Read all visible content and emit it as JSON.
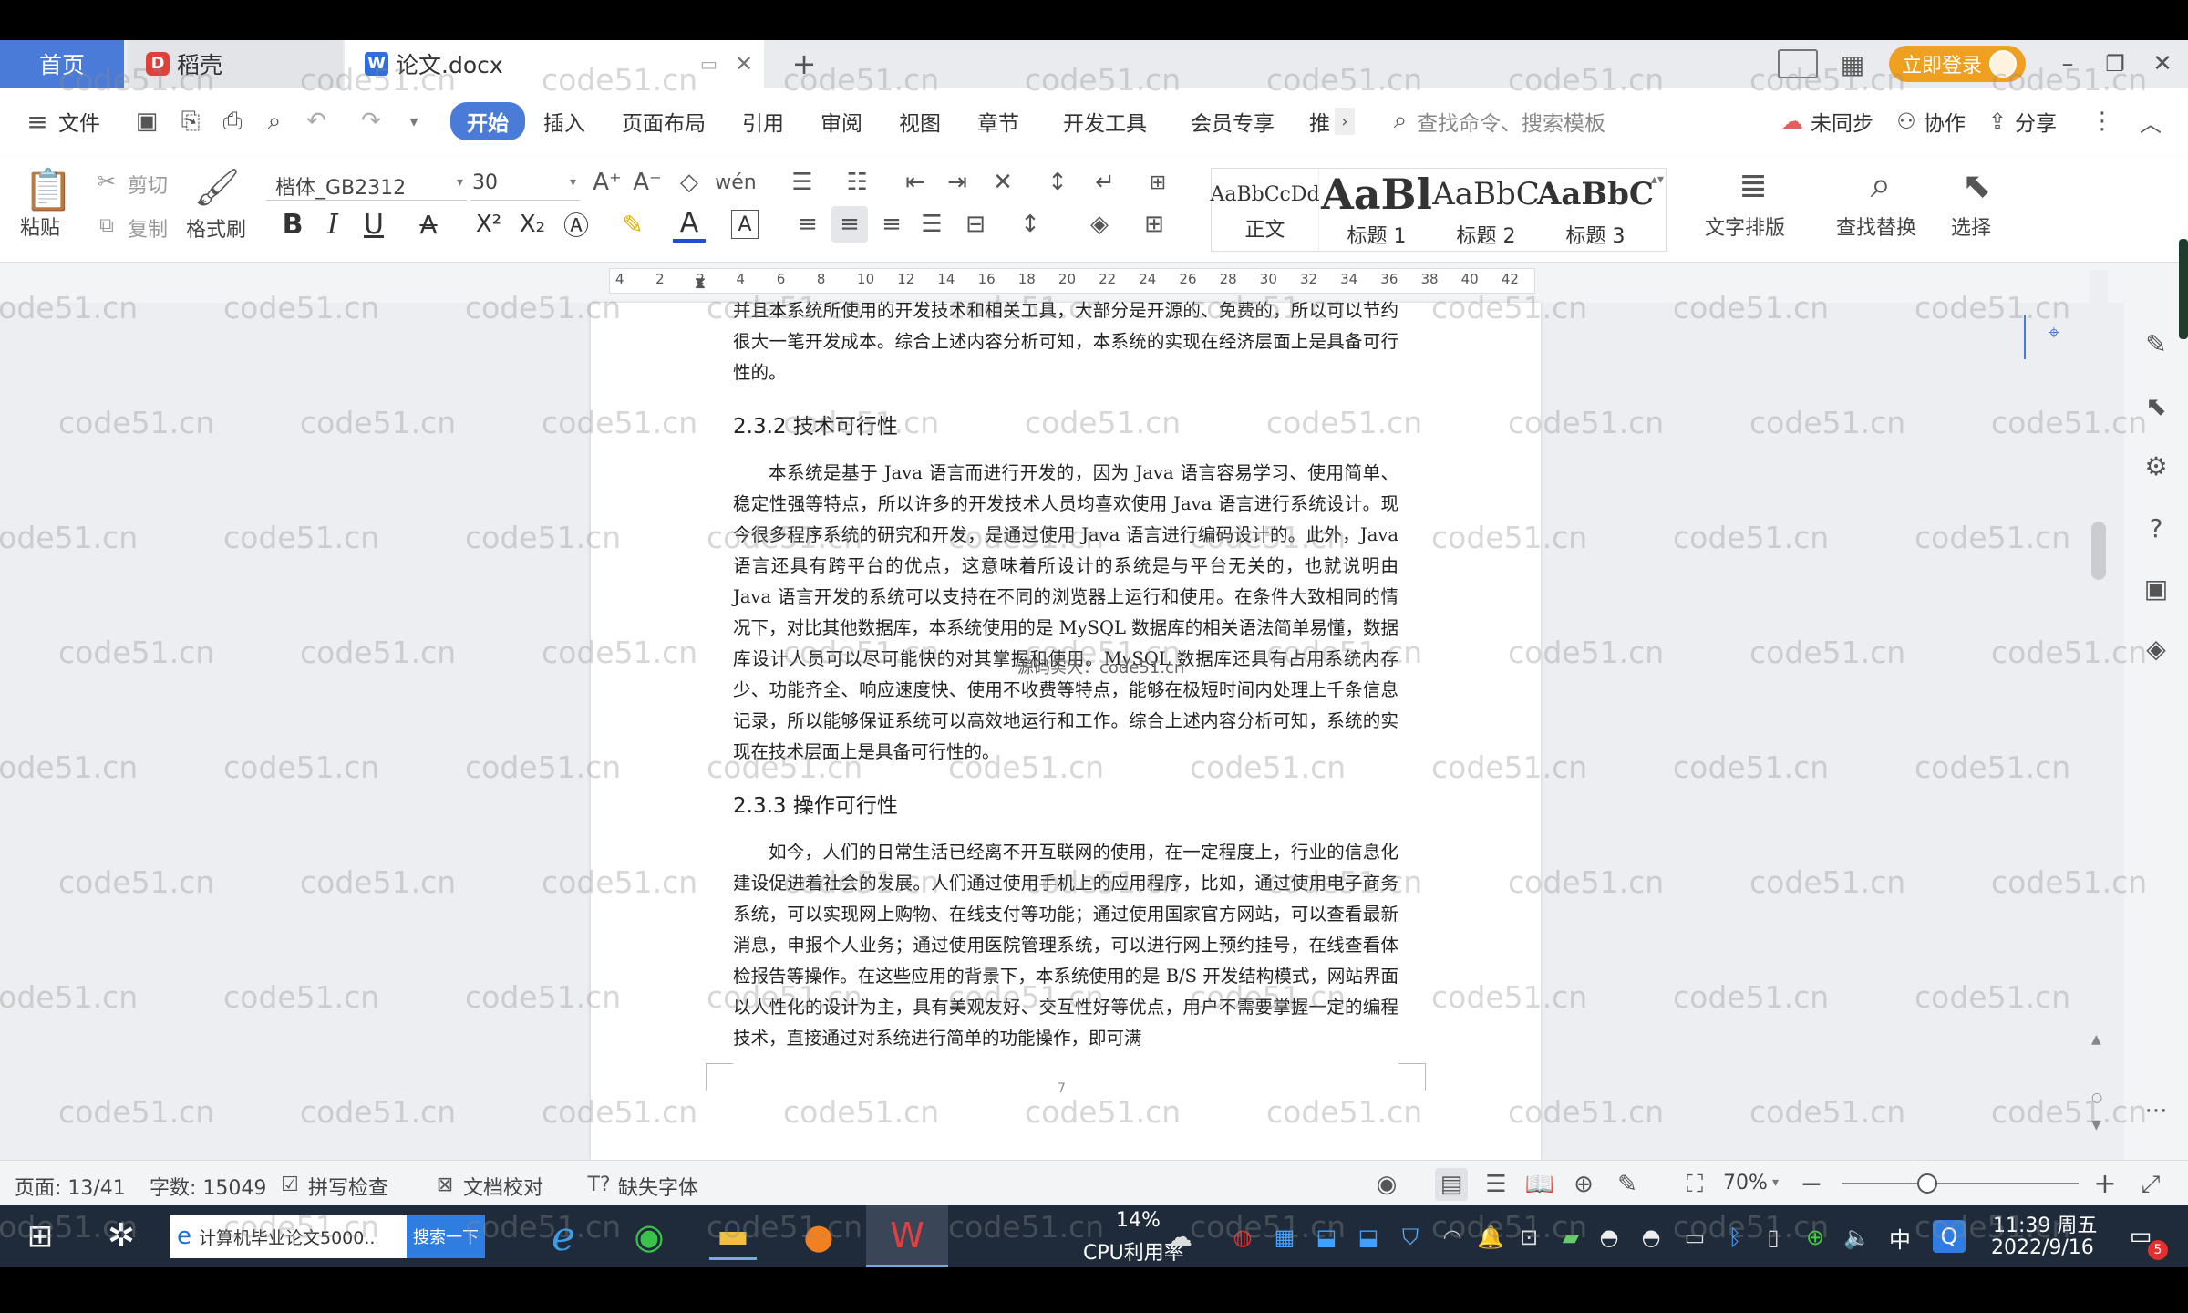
{
  "tabs": {
    "home": "首页",
    "daoke": "稻壳",
    "doc": "论文.docx",
    "login": "立即登录"
  },
  "menu": {
    "file": "文件",
    "items": [
      "开始",
      "插入",
      "页面布局",
      "引用",
      "审阅",
      "视图",
      "章节",
      "开发工具",
      "会员专享",
      "推"
    ],
    "search_placeholder": "查找命令、搜索模板",
    "sync": "未同步",
    "collab": "协作",
    "share": "分享"
  },
  "ribbon": {
    "paste": "粘贴",
    "cut": "剪切",
    "copy": "复制",
    "format_painter": "格式刷",
    "font": "楷体_GB2312",
    "size": "30",
    "styles": [
      {
        "preview": "AaBbCcDd",
        "name": "正文"
      },
      {
        "preview": "AaBl",
        "name": "标题 1"
      },
      {
        "preview": "AaBbC",
        "name": "标题 2"
      },
      {
        "preview": "AaBbC",
        "name": "标题 3"
      }
    ],
    "text_layout": "文字排版",
    "find_replace": "查找替换",
    "select": "选择"
  },
  "ruler": [
    "4",
    "2",
    "2",
    "4",
    "6",
    "8",
    "10",
    "12",
    "14",
    "16",
    "18",
    "20",
    "22",
    "24",
    "26",
    "28",
    "30",
    "32",
    "34",
    "36",
    "38",
    "40",
    "42"
  ],
  "document": {
    "para0": "并且本系统所使用的开发技术和相关工具，大部分是开源的、免费的，所以可以节约很大一笔开发成本。综合上述内容分析可知，本系统的实现在经济层面上是具备可行性的。",
    "h232": "2.3.2 技术可行性",
    "para1": "本系统是基于 Java 语言而进行开发的，因为 Java 语言容易学习、使用简单、稳定性强等特点，所以许多的开发技术人员均喜欢使用 Java 语言进行系统设计。现今很多程序系统的研究和开发，是通过使用 Java 语言进行编码设计的。此外，Java 语言还具有跨平台的优点，这意味着所设计的系统是与平台无关的，也就说明由 Java 语言开发的系统可以支持在不同的浏览器上运行和使用。在条件大致相同的情况下，对比其他数据库，本系统使用的是 MySQL 数据库的相关语法简单易懂，数据库设计人员可以尽可能快的对其掌握和使用。MySQL 数据库还具有占用系统内存少、功能齐全、响应速度快、使用不收费等特点，能够在极短时间内处理上千条信息记录，所以能够保证系统可以高效地运行和工作。综合上述内容分析可知，系统的实现在技术层面上是具备可行性的。",
    "h233": "2.3.3 操作可行性",
    "para2": "如今，人们的日常生活已经离不开互联网的使用，在一定程度上，行业的信息化建设促进着社会的发展。人们通过使用手机上的应用程序，比如，通过使用电子商务系统，可以实现网上购物、在线支付等功能；通过使用国家官方网站，可以查看最新消息，申报个人业务；通过使用医院管理系统，可以进行网上预约挂号，在线查看体检报告等操作。在这些应用的背景下，本系统使用的是 B/S 开发结构模式，网站界面以人性化的设计为主，具有美观友好、交互性好等优点，用户不需要掌握一定的编程技术，直接通过对系统进行简单的功能操作，即可满",
    "page_num": "7",
    "overlay": "源码实大：code51.cn"
  },
  "status": {
    "page": "页面: 13/41",
    "words": "字数: 15049",
    "spell": "拼写检查",
    "proof": "文档校对",
    "missing_font": "缺失字体",
    "zoom": "70%"
  },
  "taskbar": {
    "browser_task": "计算机毕业论文5000...",
    "search_btn": "搜索一下",
    "cpu_pct": "14%",
    "cpu_label": "CPU利用率",
    "ime": "中",
    "time": "11:39 周五",
    "date": "2022/9/16",
    "notif": "5"
  },
  "watermark": "code51.cn",
  "colors": {
    "accent": "#4a7bd8",
    "login": "#f0a020",
    "taskbar": "#1f2b3a"
  }
}
